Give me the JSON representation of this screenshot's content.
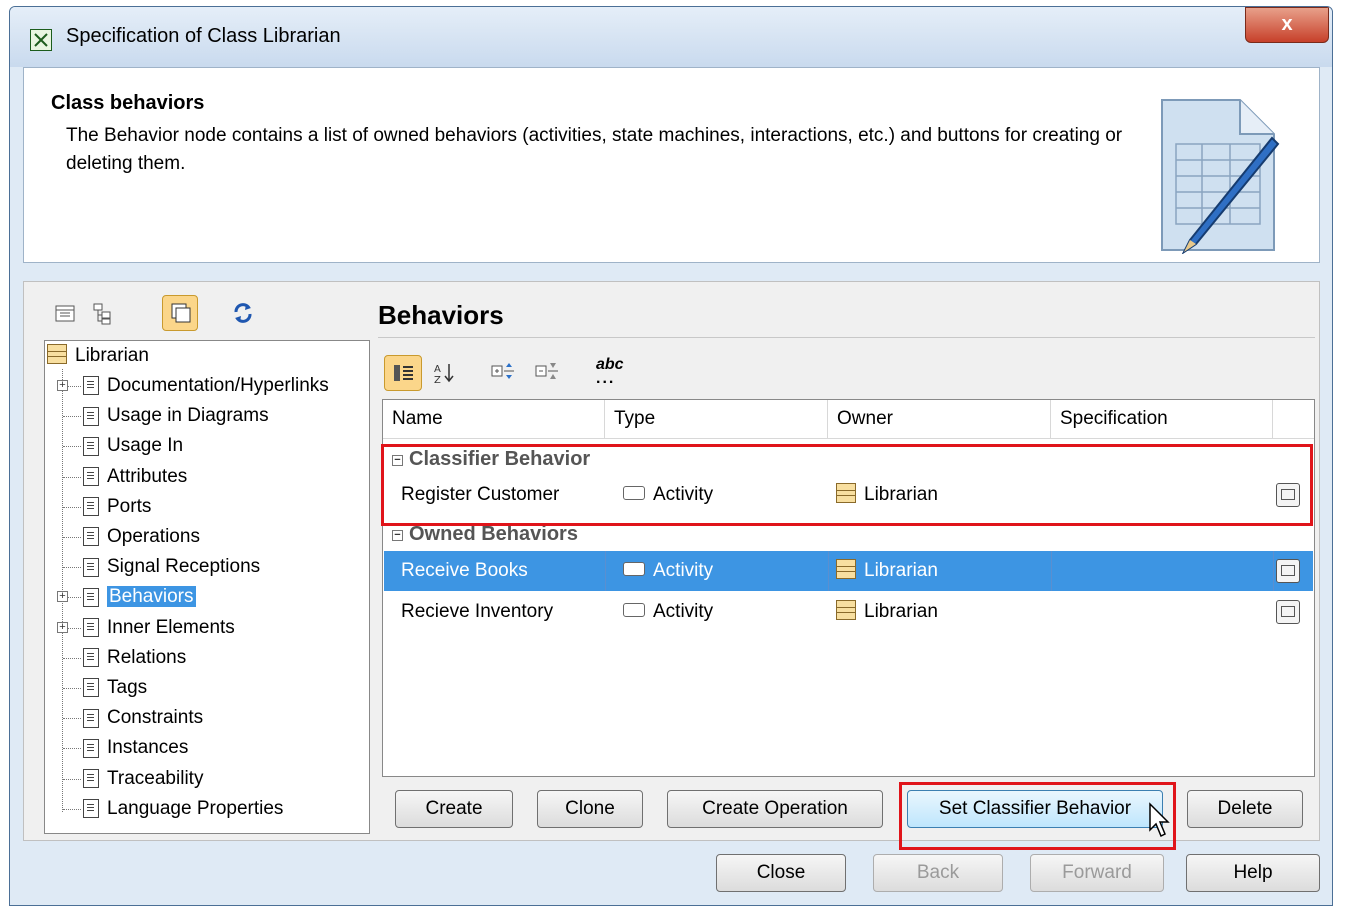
{
  "window": {
    "title": "Specification of Class Librarian",
    "close_glyph": "x"
  },
  "header": {
    "title": "Class behaviors",
    "description": "The Behavior node contains a list of owned behaviors (activities, state machines, interactions, etc.) and buttons for creating or deleting them."
  },
  "tree": {
    "root": "Librarian",
    "items": [
      "Documentation/Hyperlinks",
      "Usage in Diagrams",
      "Usage In",
      "Attributes",
      "Ports",
      "Operations",
      "Signal Receptions",
      "Behaviors",
      "Inner Elements",
      "Relations",
      "Tags",
      "Constraints",
      "Instances",
      "Traceability",
      "Language Properties"
    ],
    "selected": "Behaviors"
  },
  "panel": {
    "title": "Behaviors",
    "toolbar_abc": "abc"
  },
  "grid": {
    "columns": [
      "Name",
      "Type",
      "Owner",
      "Specification"
    ],
    "groups": [
      {
        "label": "Classifier Behavior",
        "rows": [
          {
            "name": "Register Customer",
            "type": "Activity",
            "owner": "Librarian"
          }
        ]
      },
      {
        "label": "Owned Behaviors",
        "rows": [
          {
            "name": "Receive Books",
            "type": "Activity",
            "owner": "Librarian",
            "selected": true
          },
          {
            "name": "Recieve Inventory",
            "type": "Activity",
            "owner": "Librarian"
          }
        ]
      }
    ]
  },
  "buttons": {
    "create": "Create",
    "clone": "Clone",
    "create_operation": "Create Operation",
    "set_classifier": "Set Classifier Behavior",
    "delete": "Delete",
    "close": "Close",
    "back": "Back",
    "forward": "Forward",
    "help": "Help"
  },
  "colors": {
    "selection": "#3d95e3",
    "highlight_box": "#e0141a"
  }
}
